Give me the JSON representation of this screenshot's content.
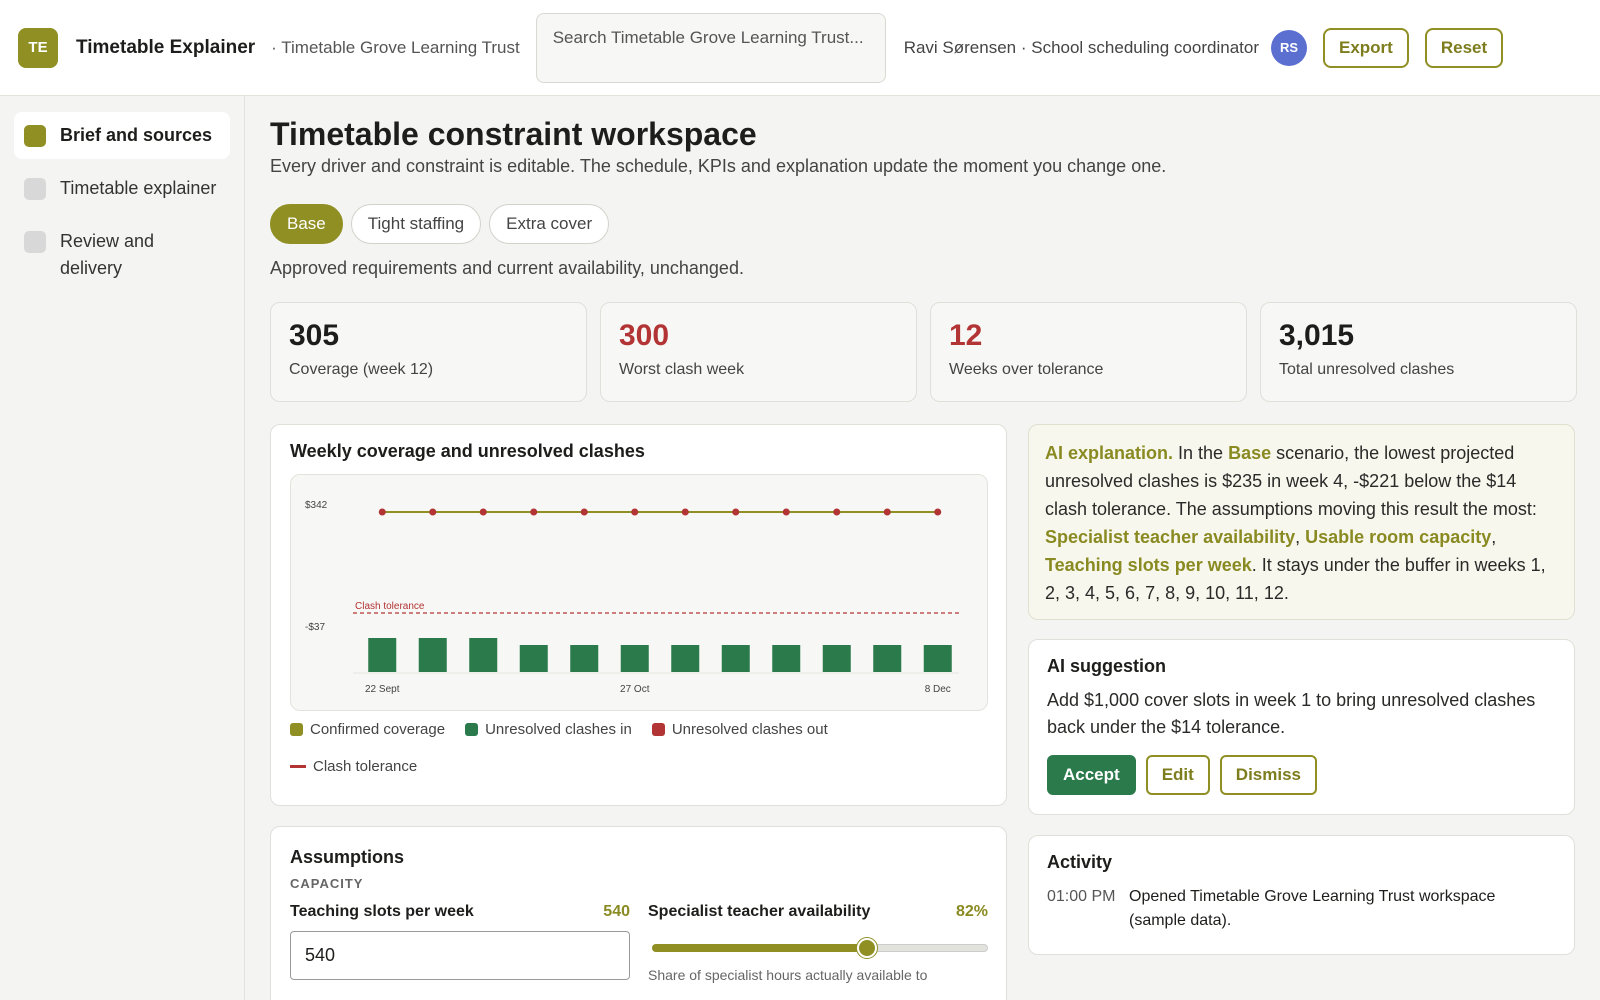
{
  "header": {
    "logo": "TE",
    "app_title": "Timetable Explainer",
    "org": "· Timetable Grove Learning Trust",
    "search_placeholder": "Search Timetable Grove Learning Trust...",
    "user": "Ravi Sørensen · School scheduling coordinator",
    "avatar": "RS",
    "export_label": "Export",
    "reset_label": "Reset"
  },
  "sidebar": {
    "items": [
      {
        "label": "Brief and sources",
        "active": true
      },
      {
        "label": "Timetable explainer",
        "active": false
      },
      {
        "label": "Review and delivery",
        "active": false
      }
    ]
  },
  "main": {
    "title": "Timetable constraint workspace",
    "subtitle": "Every driver and constraint is editable. The schedule, KPIs and explanation update the moment you change one.",
    "scenarios": [
      "Base",
      "Tight staffing",
      "Extra cover"
    ],
    "active_scenario": "Base",
    "scenario_desc": "Approved requirements and current availability, unchanged."
  },
  "kpis": [
    {
      "value": "305",
      "label": "Coverage (week 12)",
      "color": "#1d1d1b"
    },
    {
      "value": "300",
      "label": "Worst clash week",
      "color": "#b23434"
    },
    {
      "value": "12",
      "label": "Weeks over tolerance",
      "color": "#b23434"
    },
    {
      "value": "3,015",
      "label": "Total unresolved clashes",
      "color": "#1d1d1b"
    }
  ],
  "chart": {
    "title": "Weekly coverage and unresolved clashes",
    "legend": [
      {
        "label": "Confirmed coverage",
        "color": "#8f8f24",
        "kind": "square"
      },
      {
        "label": "Unresolved clashes in",
        "color": "#2b7a4b",
        "kind": "square"
      },
      {
        "label": "Unresolved clashes out",
        "color": "#b23434",
        "kind": "square"
      },
      {
        "label": "Clash tolerance",
        "color": "#b23434",
        "kind": "line"
      }
    ]
  },
  "chart_data": {
    "type": "bar",
    "title": "Weekly coverage and unresolved clashes",
    "y_tick_labels": [
      "$342",
      "-$37"
    ],
    "x_tick_labels": [
      "22 Sept",
      "27 Oct",
      "8 Dec"
    ],
    "ylim": [
      -37,
      342
    ],
    "tolerance_label": "Clash tolerance",
    "tolerance_value": 14,
    "categories": [
      1,
      2,
      3,
      4,
      5,
      6,
      7,
      8,
      9,
      10,
      11,
      12
    ],
    "series": [
      {
        "name": "Unresolved clashes in",
        "type": "bar",
        "color": "#2b7a4b",
        "values": [
          -10,
          -10,
          -10,
          -17,
          -17,
          -17,
          -17,
          -17,
          -17,
          -17,
          -17,
          -17
        ]
      },
      {
        "name": "Confirmed coverage",
        "type": "line",
        "color": "#8f8f24",
        "marker_color": "#b23434",
        "values": [
          305,
          305,
          305,
          305,
          305,
          305,
          305,
          305,
          305,
          305,
          305,
          305
        ]
      }
    ]
  },
  "ai": {
    "lead": "AI explanation.",
    "t1": " In the ",
    "scenario": "Base",
    "t2": " scenario, the lowest projected unresolved clashes is $235 in week 4, -$221 below the $14 clash tolerance. The assumptions moving this result the most: ",
    "d1": "Specialist teacher availability",
    "sep1": ", ",
    "d2": "Usable room capacity",
    "sep2": ", ",
    "d3": "Teaching slots per week",
    "t3": ". It stays under the buffer in weeks 1, 2, 3, 4, 5, 6, 7, 8, 9, 10, 11, 12."
  },
  "suggestion": {
    "title": "AI suggestion",
    "text": "Add $1,000 cover slots in week 1 to bring unresolved clashes back under the $14 tolerance.",
    "accept": "Accept",
    "edit": "Edit",
    "dismiss": "Dismiss"
  },
  "activity": {
    "title": "Activity",
    "items": [
      {
        "time": "01:00 PM",
        "text": "Opened Timetable Grove Learning Trust workspace (sample data)."
      }
    ]
  },
  "assumptions": {
    "title": "Assumptions",
    "section": "CAPACITY",
    "slots_label": "Teaching slots per week",
    "slots_value": "540",
    "slots_input": "540",
    "spec_label": "Specialist teacher availability",
    "spec_value": "82%",
    "spec_fraction": 0.64,
    "spec_help": "Share of specialist hours actually available to"
  }
}
